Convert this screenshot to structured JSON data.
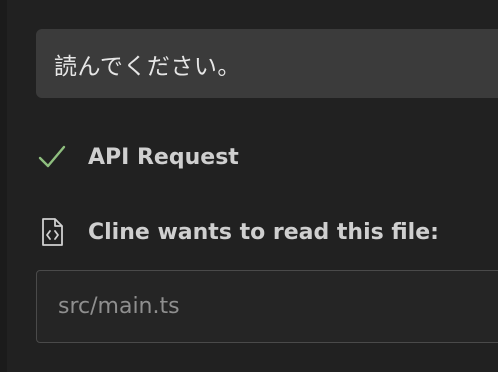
{
  "user_message": {
    "text": "読んでください。"
  },
  "api_request": {
    "status_icon": "check-icon",
    "label": "API Request",
    "check_color": "#8fbf7f"
  },
  "file_read": {
    "icon": "file-code-icon",
    "label": "Cline wants to read this file:",
    "path": "src/main.ts"
  }
}
